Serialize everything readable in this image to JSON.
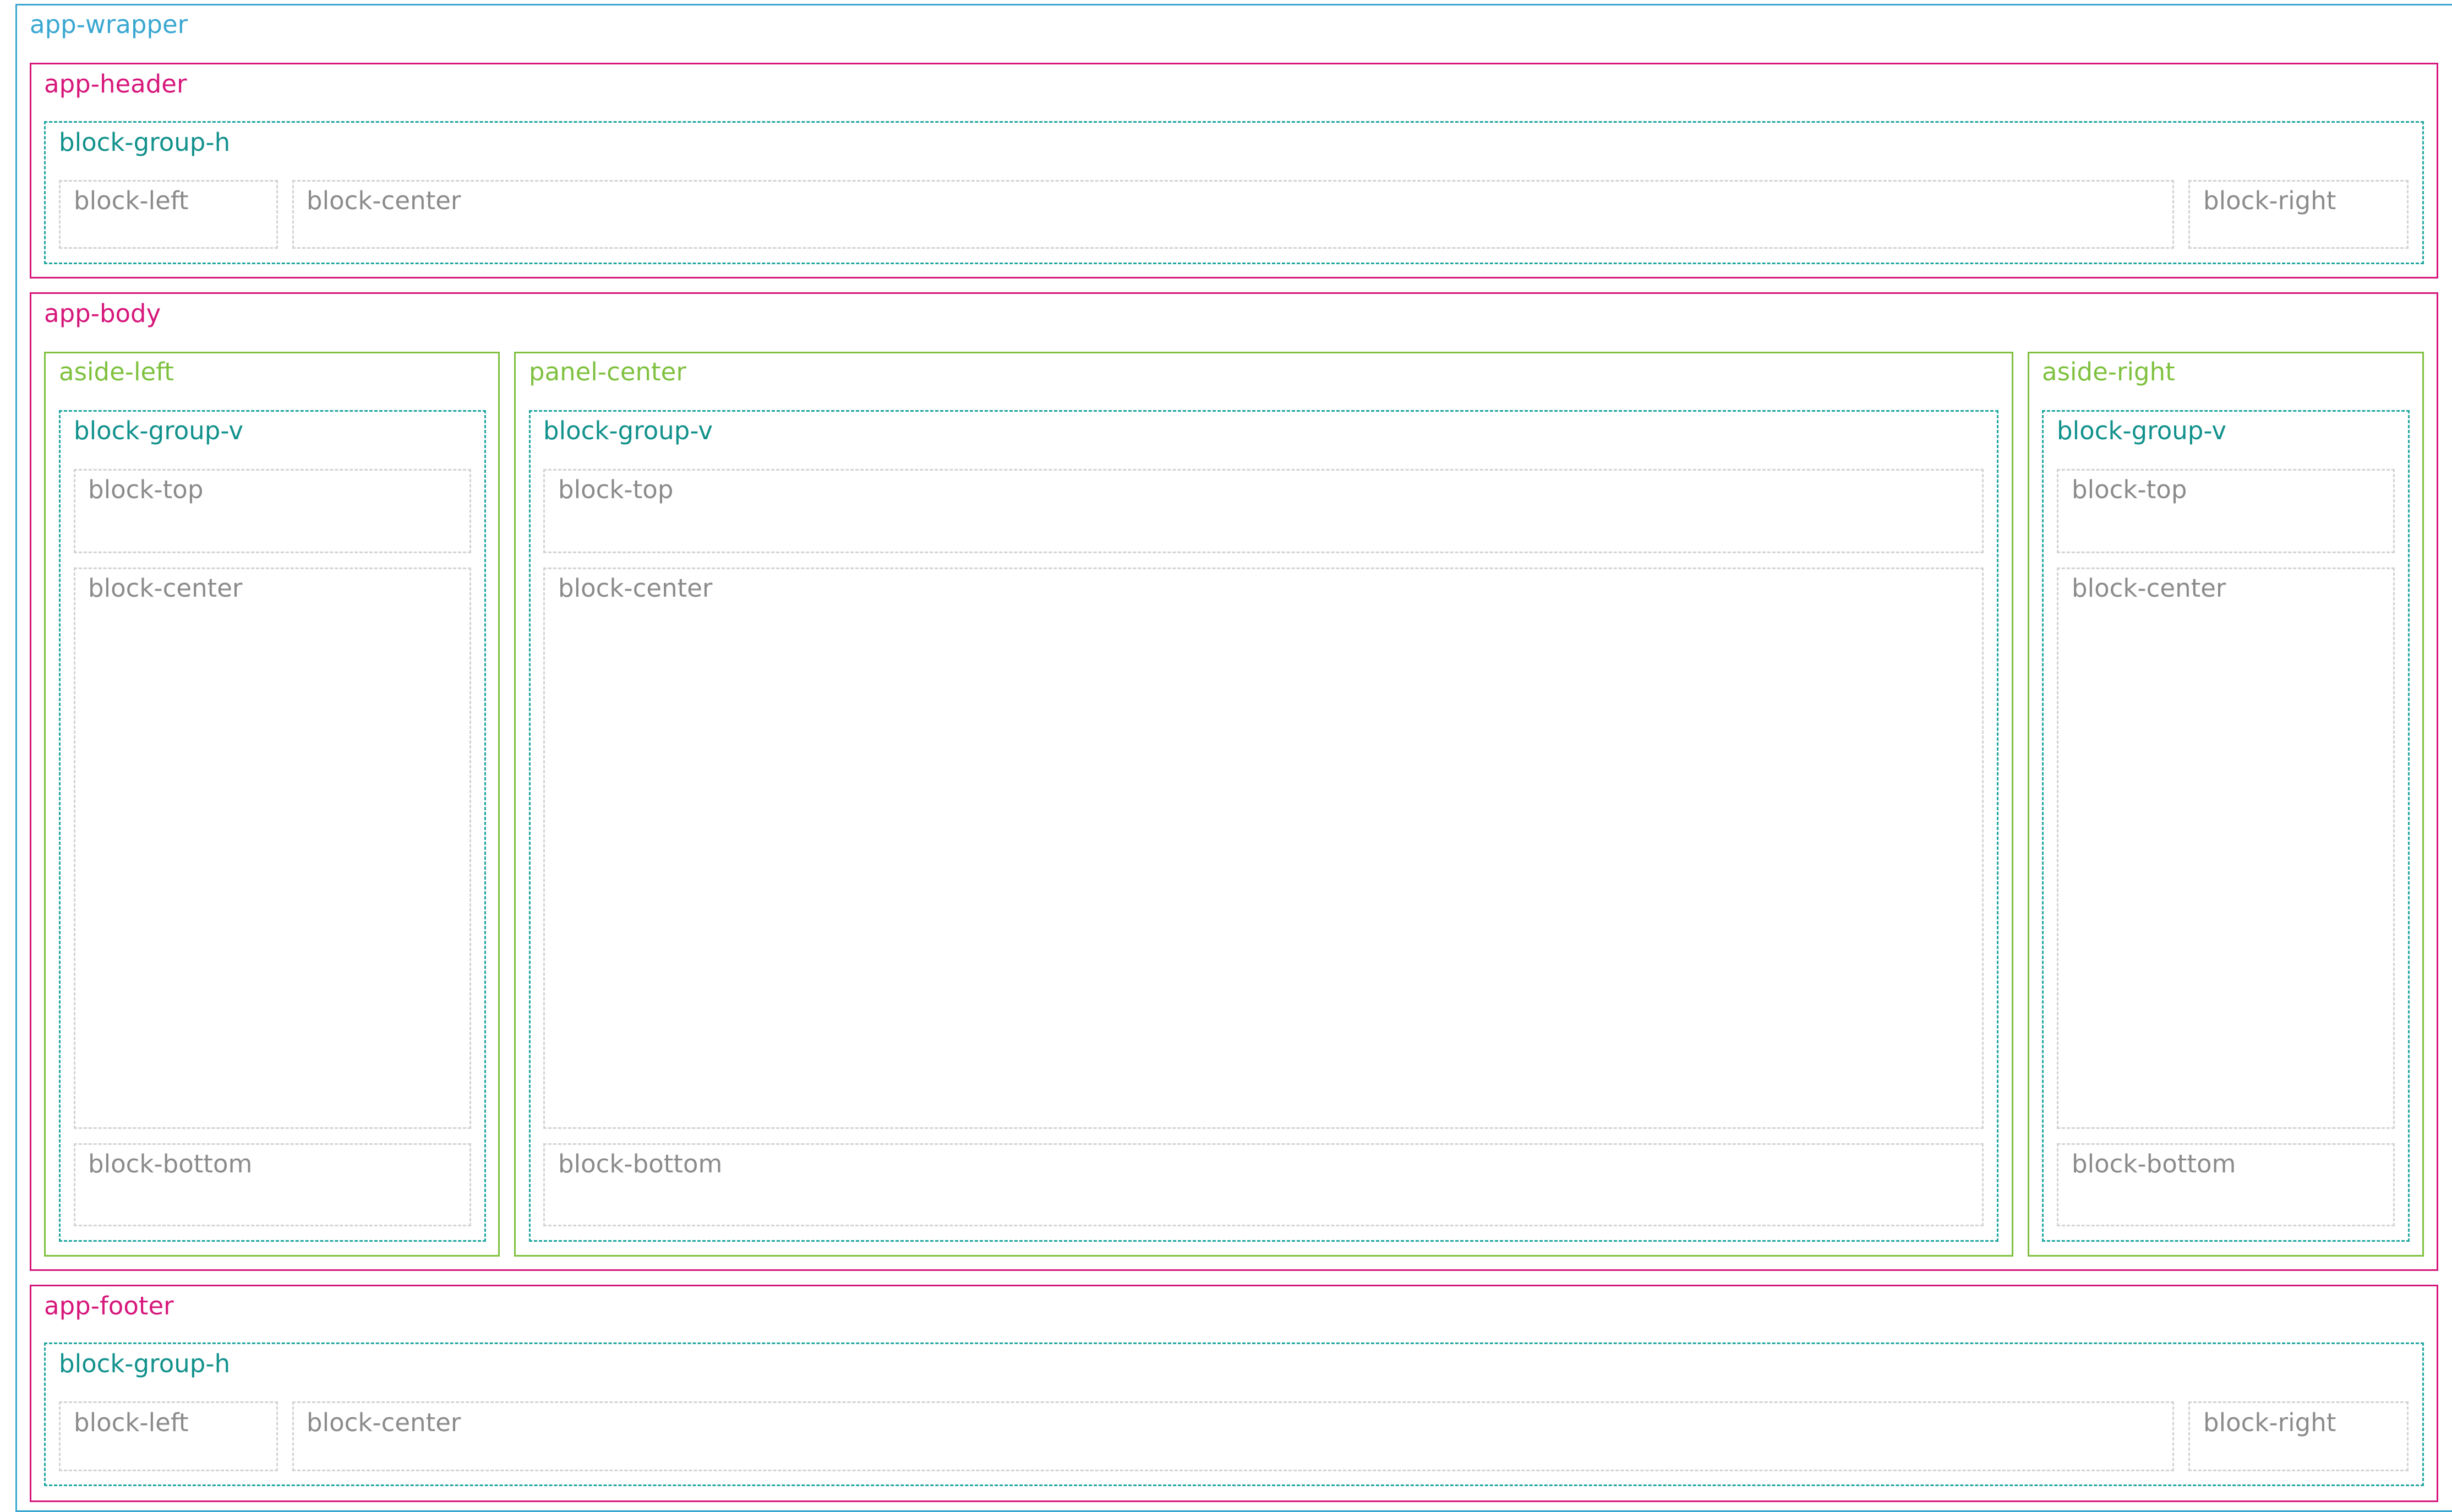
{
  "app_wrapper": {
    "label": "app-wrapper"
  },
  "app_header": {
    "label": "app-header",
    "group": {
      "label": "block-group-h",
      "blocks": {
        "left": "block-left",
        "center": "block-center",
        "right": "block-right"
      }
    }
  },
  "app_body": {
    "label": "app-body",
    "aside_left": {
      "label": "aside-left",
      "group": {
        "label": "block-group-v",
        "blocks": {
          "top": "block-top",
          "center": "block-center",
          "bottom": "block-bottom"
        }
      }
    },
    "panel_center": {
      "label": "panel-center",
      "group": {
        "label": "block-group-v",
        "blocks": {
          "top": "block-top",
          "center": "block-center",
          "bottom": "block-bottom"
        }
      }
    },
    "aside_right": {
      "label": "aside-right",
      "group": {
        "label": "block-group-v",
        "blocks": {
          "top": "block-top",
          "center": "block-center",
          "bottom": "block-bottom"
        }
      }
    }
  },
  "app_footer": {
    "label": "app-footer",
    "group": {
      "label": "block-group-h",
      "blocks": {
        "left": "block-left",
        "center": "block-center",
        "right": "block-right"
      }
    }
  },
  "colors": {
    "wrapper": "#3aa7d1",
    "region": "#d6177b",
    "panel": "#7fc13f",
    "group": "#21a6a0",
    "block": "#d3d3d3",
    "block_text": "#8b8b8b"
  }
}
